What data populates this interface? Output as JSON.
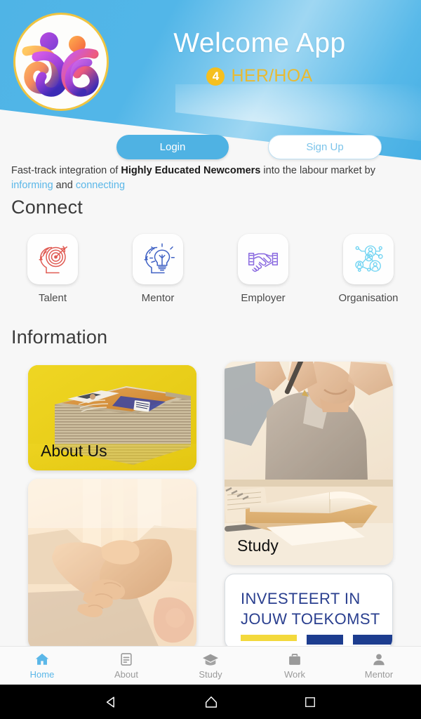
{
  "header": {
    "app_title": "Welcome App",
    "badge_number": "4",
    "badge_text": "HER/HOA",
    "logo_icon": "welcome-app-logo",
    "accent_blue": "#4fb2e3",
    "accent_gold": "#e8ba33"
  },
  "auth": {
    "login_label": "Login",
    "signup_label": "Sign Up"
  },
  "tagline": {
    "part1": "Fast-track integration of ",
    "bold": "Highly Educated Newcomers",
    "part2": " into the labour market by ",
    "link1": "informing",
    "part3": " and ",
    "link2": "connecting",
    "link_color": "#5bb7e8"
  },
  "sections": {
    "connect_heading": "Connect",
    "information_heading": "Information"
  },
  "connect": {
    "items": [
      {
        "label": "Talent",
        "icon": "head-target-icon",
        "color": "#e05b53"
      },
      {
        "label": "Mentor",
        "icon": "head-lightbulb-icon",
        "color": "#3f61c4"
      },
      {
        "label": "Employer",
        "icon": "handshake-icon",
        "color": "#8a6ae0"
      },
      {
        "label": "Organisation",
        "icon": "network-people-icon",
        "color": "#6ed3f2"
      }
    ]
  },
  "information": {
    "cards": [
      {
        "label": "About Us",
        "image": "magazine-stack-photo",
        "bg": "#ead11a"
      },
      {
        "label": "Study",
        "image": "person-writing-photo",
        "bg": "#f3ece2"
      },
      {
        "label": "",
        "image": "handshake-photo",
        "bg": "#f6ece0"
      }
    ],
    "eu_card": {
      "line1": "INVESTEERT IN",
      "line2": "JOUW TOEKOMST",
      "text_color": "#2a3f8f",
      "accent_yellow": "#f3d93c",
      "accent_blue": "#1d3d8f"
    }
  },
  "tabbar": {
    "active": "Home",
    "items": [
      {
        "label": "Home",
        "icon": "home-icon"
      },
      {
        "label": "About",
        "icon": "document-icon"
      },
      {
        "label": "Study",
        "icon": "graduation-cap-icon"
      },
      {
        "label": "Work",
        "icon": "briefcase-icon"
      },
      {
        "label": "Mentor",
        "icon": "person-icon"
      }
    ]
  },
  "system_nav": {
    "back": "back-icon",
    "home": "home-icon",
    "recents": "recents-icon"
  }
}
